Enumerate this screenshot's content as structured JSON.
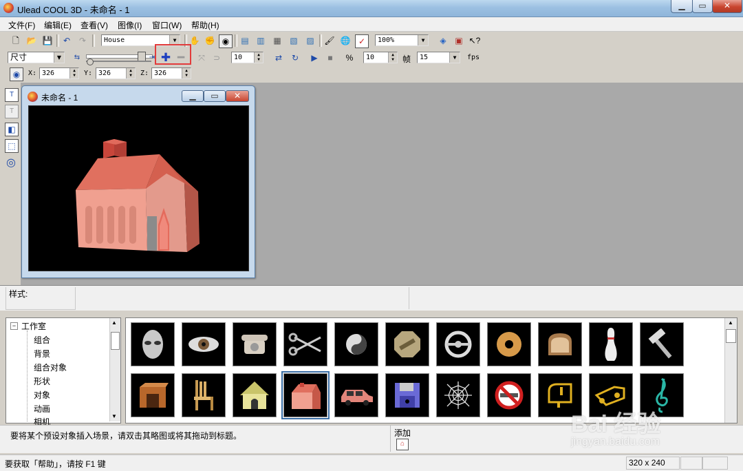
{
  "window": {
    "title": "Ulead COOL 3D - 未命名 - 1"
  },
  "menu": [
    "文件(F)",
    "编辑(E)",
    "查看(V)",
    "图像(I)",
    "窗口(W)",
    "帮助(H)"
  ],
  "toolbar": {
    "object_select": "House",
    "zoom": "100%"
  },
  "toolbar2": {
    "attribute_select": "尺寸",
    "value1": "10",
    "value2": "10",
    "frame_label": "帧",
    "fps_value": "15",
    "fps_label": "fps"
  },
  "coords": {
    "x_label": "X:",
    "x_value": "326",
    "y_label": "Y:",
    "y_value": "326",
    "z_label": "Z:",
    "z_value": "326"
  },
  "document": {
    "title": "未命名 - 1"
  },
  "style_row": {
    "label": "样式:"
  },
  "tree": {
    "root": "工作室",
    "items": [
      "组合",
      "背景",
      "组合对象",
      "形状",
      "对象",
      "动画",
      "相机"
    ]
  },
  "thumbnails_row1": [
    "alien-mask",
    "eye",
    "telephone",
    "scissors",
    "yin-yang",
    "stop-sign",
    "steering-wheel",
    "donut",
    "bread",
    "bowling-pin",
    "hammer"
  ],
  "thumbnails_row2": [
    "wooden-box",
    "chair",
    "doghouse",
    "house",
    "car",
    "floppy-disk",
    "spider-web",
    "no-smoking",
    "mailbox",
    "music-notes",
    "treble-clef"
  ],
  "hint": {
    "text": "要将某个预设对象插入场景，请双击其略图或将其拖动到标题。",
    "add_label": "添加"
  },
  "status": {
    "help": "要获取「帮助」，请按 F1 键",
    "size": "320 x 240"
  },
  "watermark": {
    "brand": "Bai 经验",
    "url": "jingyan.baidu.com"
  },
  "colors": {
    "highlight_box": "#e23b3b",
    "house": "#e0705f"
  }
}
